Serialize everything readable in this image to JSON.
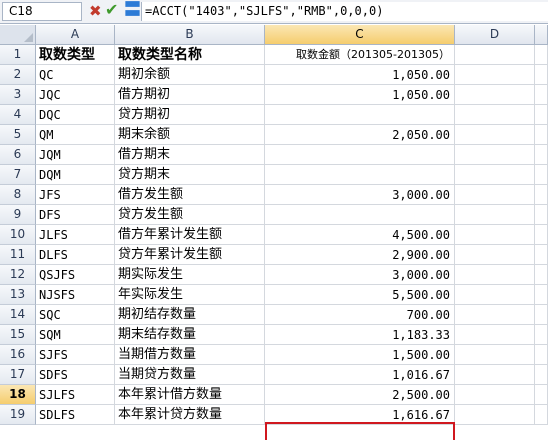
{
  "formula_bar": {
    "name_box": "C18",
    "cancel_glyph": "✖",
    "enter_glyph": "✔",
    "function_glyph": "〓",
    "formula": "=ACCT(\"1403\",\"SJLFS\",\"RMB\",0,0,0)"
  },
  "columns": [
    "A",
    "B",
    "C",
    "D"
  ],
  "rows": [
    {
      "num": "1",
      "a": "取数类型",
      "b": "取数类型名称",
      "c": "取数金额（201305-201305）"
    },
    {
      "num": "2",
      "a": "QC",
      "b": "期初余额",
      "c": "1,050.00"
    },
    {
      "num": "3",
      "a": "JQC",
      "b": "借方期初",
      "c": "1,050.00"
    },
    {
      "num": "4",
      "a": "DQC",
      "b": "贷方期初",
      "c": ""
    },
    {
      "num": "5",
      "a": "QM",
      "b": "期末余额",
      "c": "2,050.00"
    },
    {
      "num": "6",
      "a": "JQM",
      "b": "借方期末",
      "c": ""
    },
    {
      "num": "7",
      "a": "DQM",
      "b": "贷方期末",
      "c": ""
    },
    {
      "num": "8",
      "a": "JFS",
      "b": "借方发生额",
      "c": "3,000.00"
    },
    {
      "num": "9",
      "a": "DFS",
      "b": "贷方发生额",
      "c": ""
    },
    {
      "num": "10",
      "a": "JLFS",
      "b": "借方年累计发生额",
      "c": "4,500.00"
    },
    {
      "num": "11",
      "a": "DLFS",
      "b": "贷方年累计发生额",
      "c": "2,900.00"
    },
    {
      "num": "12",
      "a": "QSJFS",
      "b": "期实际发生",
      "c": "3,000.00"
    },
    {
      "num": "13",
      "a": "NJSFS",
      "b": "年实际发生",
      "c": "5,500.00"
    },
    {
      "num": "14",
      "a": "SQC",
      "b": "期初结存数量",
      "c": "700.00"
    },
    {
      "num": "15",
      "a": "SQM",
      "b": "期末结存数量",
      "c": "1,183.33"
    },
    {
      "num": "16",
      "a": "SJFS",
      "b": "当期借方数量",
      "c": "1,500.00"
    },
    {
      "num": "17",
      "a": "SDFS",
      "b": "当期贷方数量",
      "c": "1,016.67"
    },
    {
      "num": "18",
      "a": "SJLFS",
      "b": "本年累计借方数量",
      "c": "2,500.00"
    },
    {
      "num": "19",
      "a": "SDLFS",
      "b": "本年累计贷方数量",
      "c": "1,616.67"
    }
  ],
  "colors": {
    "selection_border": "#d0181f",
    "active_header": "#f5cd6e"
  }
}
